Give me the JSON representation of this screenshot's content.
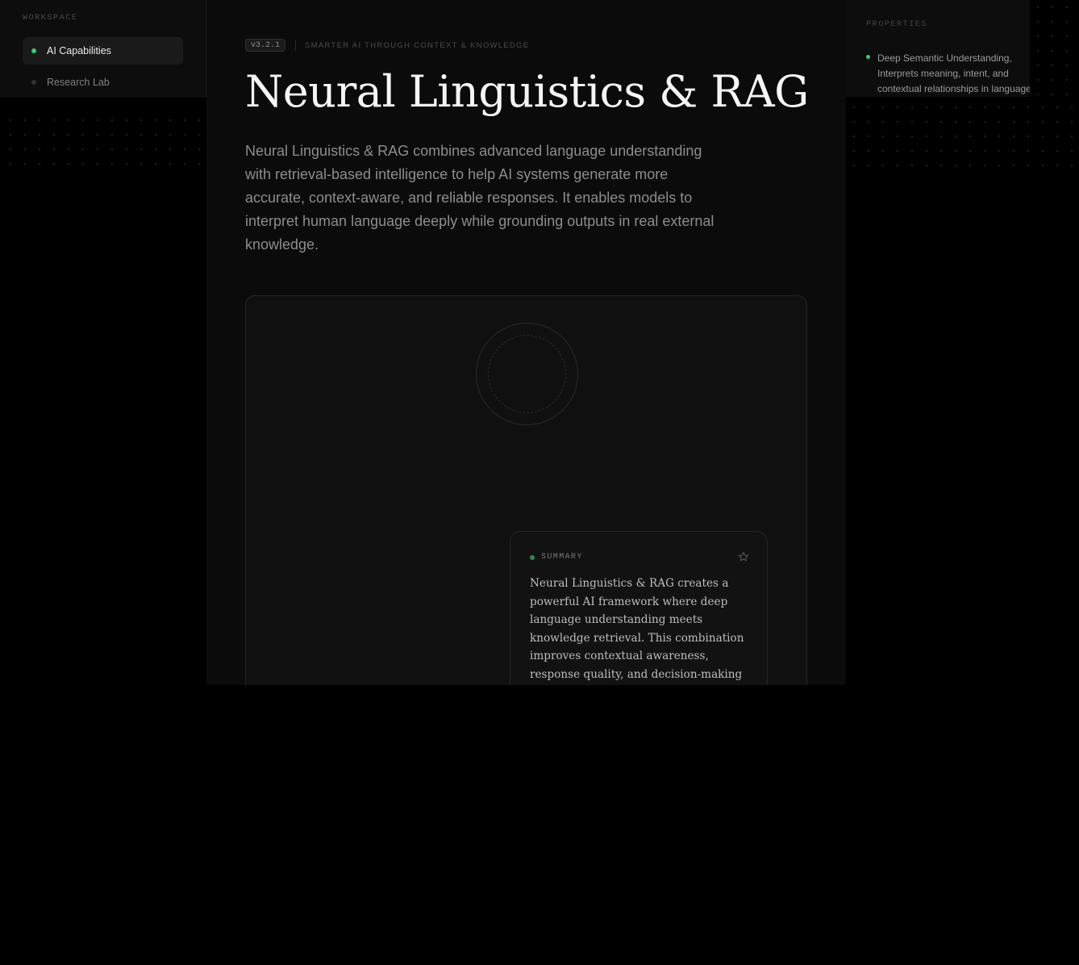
{
  "sidebar": {
    "heading": "WORKSPACE",
    "items": [
      {
        "label": "AI Capabilities",
        "active": true
      },
      {
        "label": "Research Lab",
        "active": false
      }
    ]
  },
  "main": {
    "version": "v3.2.1",
    "tagline": "SMARTER AI THROUGH CONTEXT & KNOWLEDGE",
    "title": "Neural Linguistics & RAG",
    "intro": "Neural Linguistics & RAG combines advanced language understanding with retrieval-based intelligence to help AI systems generate more accurate, context-aware, and reliable responses. It enables models to interpret human language deeply while grounding outputs in real external knowledge."
  },
  "summary": {
    "label": "SUMMARY",
    "icon": "star-icon",
    "text": "Neural Linguistics & RAG creates a powerful AI framework where deep language understanding meets knowledge retrieval. This combination improves contextual awareness, response quality, and decision-making by ensuring AI"
  },
  "properties": {
    "heading": "PROPERTIES",
    "items": [
      {
        "line1": "Deep Semantic Understanding,",
        "line2": "Interprets meaning, intent, and",
        "line3": "contextual relationships in language"
      }
    ]
  },
  "colors": {
    "accent": "#2fd36a",
    "background": "#000000",
    "panel": "#0b0b0b"
  }
}
